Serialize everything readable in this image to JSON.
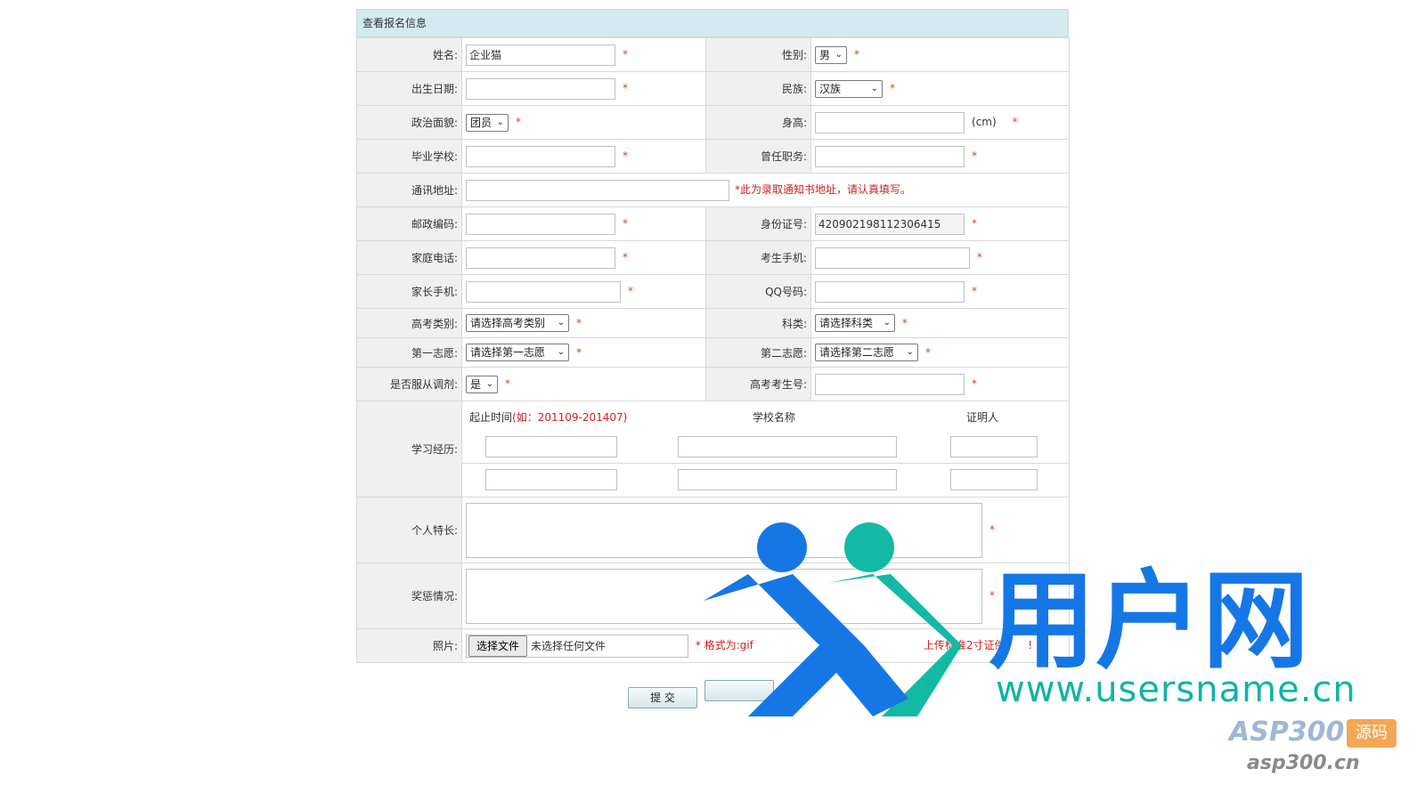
{
  "header": {
    "title": "查看报名信息"
  },
  "fields": {
    "name": {
      "label": "姓名:",
      "value": "企业猫"
    },
    "gender": {
      "label": "性别:",
      "value": "男"
    },
    "birth": {
      "label": "出生日期:",
      "value": ""
    },
    "ethnic": {
      "label": "民族:",
      "value": "汉族"
    },
    "political": {
      "label": "政治面貌:",
      "value": "团员"
    },
    "height": {
      "label": "身高:",
      "value": "",
      "unit": "(cm)"
    },
    "school": {
      "label": "毕业学校:",
      "value": ""
    },
    "position": {
      "label": "曾任职务:",
      "value": ""
    },
    "address": {
      "label": "通讯地址:",
      "value": "",
      "note": "*此为录取通知书地址，请认真填写。"
    },
    "zip": {
      "label": "邮政编码:",
      "value": ""
    },
    "idcard": {
      "label": "身份证号:",
      "value": "420902198112306415"
    },
    "homephone": {
      "label": "家庭电话:",
      "value": ""
    },
    "mobile": {
      "label": "考生手机:",
      "value": ""
    },
    "parentmobile": {
      "label": "家长手机:",
      "value": ""
    },
    "qq": {
      "label": "QQ号码:",
      "value": ""
    },
    "examtype": {
      "label": "高考类别:",
      "value": "请选择高考类别"
    },
    "subject": {
      "label": "科类:",
      "value": "请选择科类"
    },
    "choice1": {
      "label": "第一志愿:",
      "value": "请选择第一志愿"
    },
    "choice2": {
      "label": "第二志愿:",
      "value": "请选择第二志愿"
    },
    "adjust": {
      "label": "是否服从调剂:",
      "value": "是"
    },
    "examno": {
      "label": "高考考生号:",
      "value": ""
    },
    "education": {
      "label": "学习经历:",
      "col_time": "起止时间",
      "col_time_hint": "(如：201109-201407)",
      "col_school": "学校名称",
      "col_witness": "证明人"
    },
    "talent": {
      "label": "个人特长:"
    },
    "awards": {
      "label": "奖惩情况:"
    },
    "photo": {
      "label": "照片:",
      "button": "选择文件",
      "status": "未选择任何文件",
      "format": "* 格式为:gif",
      "note_mid": "于20",
      "note_end": "上传标准2寸证件",
      "note_tail": "!"
    }
  },
  "required_mark": "*",
  "buttons": {
    "submit": "提 交"
  },
  "watermark": {
    "brand": "用户网",
    "url": "www.usersname.cn",
    "asp": "ASP300",
    "asp_tag": "源码",
    "asp_url": "asp300.cn"
  }
}
